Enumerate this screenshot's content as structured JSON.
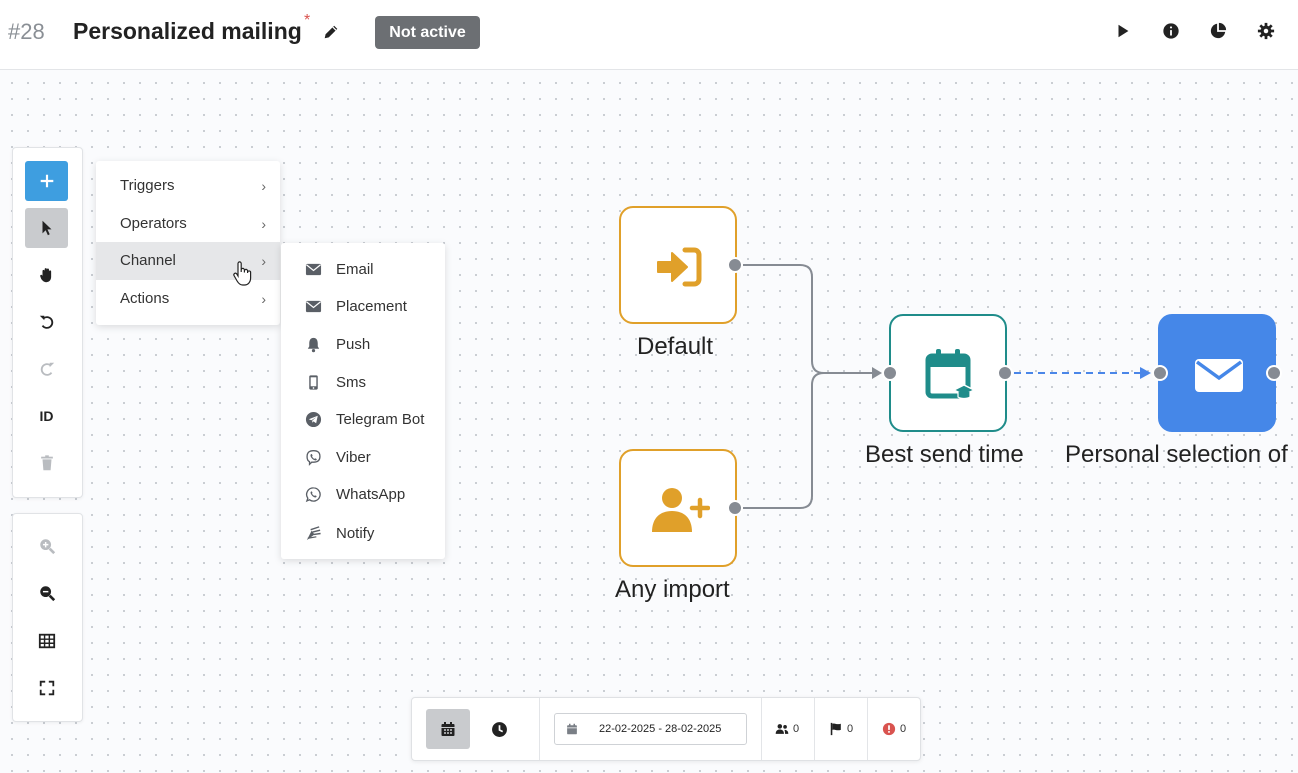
{
  "header": {
    "number": "#28",
    "title": "Personalized mailing",
    "required_mark": "*",
    "status": "Not active",
    "icons": [
      "play-icon",
      "info-icon",
      "chart-pie-icon",
      "gear-icon"
    ]
  },
  "toolbar": {
    "id_label": "ID",
    "icons": [
      "plus-icon",
      "cursor-icon",
      "hand-icon",
      "undo-icon",
      "redo-icon",
      "trash-icon",
      "zoom-in-icon",
      "zoom-out-icon",
      "table-icon",
      "expand-icon"
    ]
  },
  "menu": {
    "items": [
      {
        "label": "Triggers"
      },
      {
        "label": "Operators"
      },
      {
        "label": "Channel"
      },
      {
        "label": "Actions"
      }
    ]
  },
  "submenu": {
    "items": [
      {
        "label": "Email",
        "icon": "envelope-icon"
      },
      {
        "label": "Placement",
        "icon": "envelope-icon"
      },
      {
        "label": "Push",
        "icon": "bell-icon"
      },
      {
        "label": "Sms",
        "icon": "phone-icon"
      },
      {
        "label": "Telegram Bot",
        "icon": "telegram-icon"
      },
      {
        "label": "Viber",
        "icon": "viber-icon"
      },
      {
        "label": "WhatsApp",
        "icon": "whatsapp-icon"
      },
      {
        "label": "Notify",
        "icon": "notify-icon"
      }
    ]
  },
  "nodes": {
    "default": {
      "label": "Default",
      "icon": "sign-in-icon"
    },
    "any_import": {
      "label": "Any import",
      "icon": "user-plus-icon"
    },
    "best_send_time": {
      "label": "Best send time",
      "icon": "calendar-icon"
    },
    "personal_selection": {
      "label": "Personal selection of",
      "icon": "envelope-icon"
    }
  },
  "bottombar": {
    "date_range": "22-02-2025 - 28-02-2025",
    "users_count": "0",
    "goals_count": "0",
    "errors_count": "0",
    "icons": [
      "calendar-icon",
      "clock-icon",
      "users-icon",
      "flag-icon",
      "error-icon"
    ]
  },
  "colors": {
    "accent_blue": "#3e9ee0",
    "node_orange": "#e0a02a",
    "node_teal": "#1f8c8a",
    "node_blue": "#4587e8",
    "badge_gray": "#6c6f73",
    "connector": "#868b93",
    "dashed_link": "#4a86e8",
    "error_red": "#d9534f"
  }
}
